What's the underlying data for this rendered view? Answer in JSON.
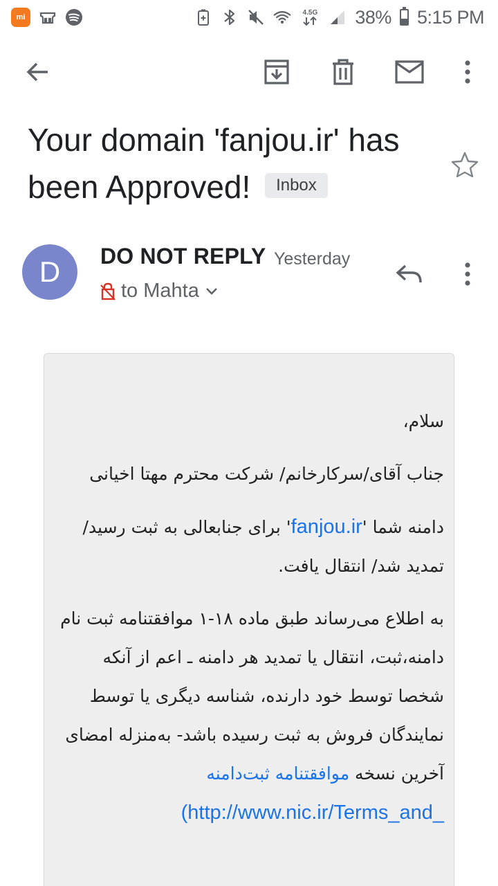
{
  "status_bar": {
    "battery": "38%",
    "time": "5:15 PM",
    "network": "4.5G"
  },
  "toolbar": {
    "icons": [
      "back-arrow-icon",
      "archive-icon",
      "delete-icon",
      "mail-icon",
      "more-vert-icon"
    ]
  },
  "email": {
    "subject": "Your domain 'fanjou.ir' has been Approved!",
    "label": "Inbox",
    "sender": {
      "initial": "D",
      "name": "DO NOT REPLY",
      "time": "Yesterday",
      "recipient": "to Mahta",
      "avatar_color": "#7986cb"
    },
    "body": {
      "greeting": "سلام،",
      "salutation": "جناب آقای/سرکارخانم/ شرکت محترم مهتا اخیانی",
      "p3_before": "دامنه شما '",
      "p3_link": "fanjou.ir",
      "p3_after": "' برای جنابعالی به ثبت رسید/تمدید شد/ انتقال یافت.",
      "p4_text": "به اطلاع می‌رساند طبق ماده ۱۸-۱ موافقتنامه ثبت نام دامنه،ثبت، انتقال یا تمدید هر دامنه ـ اعم از آنکه شخصا توسط خود دارنده، شناسه دیگری یا توسط نمایندگان فروش به ثبت رسیده باشد- به‌منزله امضای آخرین نسخه ",
      "p4_link": "موافقتنامه ثبت‌دامنه",
      "p4_url": "(http://www.nic.ir/Terms_and_"
    }
  },
  "colors": {
    "link": "#1a73e8",
    "body_bg": "#eeeeee",
    "mi_orange": "#f47a1f"
  }
}
